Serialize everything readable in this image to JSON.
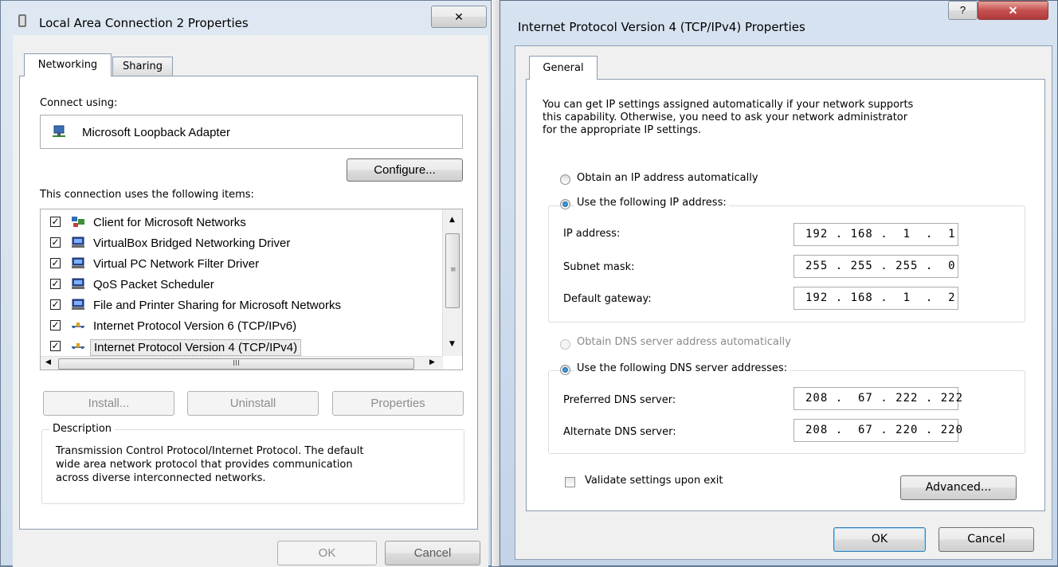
{
  "left_dialog": {
    "title": "Local Area Connection 2 Properties",
    "close_glyph": "✕",
    "tabs": [
      {
        "label": "Networking",
        "active": true
      },
      {
        "label": "Sharing",
        "active": false
      }
    ],
    "connect_using_label": "Connect using:",
    "adapter_name": "Microsoft Loopback Adapter",
    "configure_button": "Configure...",
    "items_label": "This connection uses the following items:",
    "items": [
      {
        "label": "Client for Microsoft Networks",
        "checked": true,
        "icon": "network-client-icon"
      },
      {
        "label": "VirtualBox Bridged Networking Driver",
        "checked": true,
        "icon": "network-service-icon"
      },
      {
        "label": "Virtual PC Network Filter Driver",
        "checked": true,
        "icon": "network-service-icon"
      },
      {
        "label": "QoS Packet Scheduler",
        "checked": true,
        "icon": "network-service-icon"
      },
      {
        "label": "File and Printer Sharing for Microsoft Networks",
        "checked": true,
        "icon": "network-service-icon"
      },
      {
        "label": "Internet Protocol Version 6 (TCP/IPv6)",
        "checked": true,
        "icon": "protocol-icon"
      },
      {
        "label": "Internet Protocol Version 4 (TCP/IPv4)",
        "checked": true,
        "icon": "protocol-icon",
        "selected": true
      }
    ],
    "hscroll_grip": "III",
    "install_button": "Install...",
    "uninstall_button": "Uninstall",
    "properties_button": "Properties",
    "description_label": "Description",
    "description_text": [
      "Transmission Control Protocol/Internet Protocol. The default",
      "wide area network protocol that provides communication",
      "across diverse interconnected networks."
    ],
    "ok_button": "OK",
    "cancel_button": "Cancel"
  },
  "right_dialog": {
    "title": "Internet Protocol Version 4 (TCP/IPv4) Properties",
    "help_glyph": "?",
    "close_glyph": "✕",
    "tab": "General",
    "intro": [
      "You can get IP settings assigned automatically if your network supports",
      "this capability. Otherwise, you need to ask your network administrator",
      "for the appropriate IP settings."
    ],
    "radio_auto_ip": "Obtain an IP address automatically",
    "radio_manual_ip": "Use the following IP address:",
    "ip_label": "IP address:",
    "ip_value": "192 . 168 .  1  .  1",
    "subnet_label": "Subnet mask:",
    "subnet_value": "255 . 255 . 255 .  0",
    "gateway_label": "Default gateway:",
    "gateway_value": "192 . 168 .  1  .  2",
    "radio_auto_dns": "Obtain DNS server address automatically",
    "radio_manual_dns": "Use the following DNS server addresses:",
    "preferred_dns_label": "Preferred DNS server:",
    "preferred_dns_value": "208 .  67 . 222 . 222",
    "alternate_dns_label": "Alternate DNS server:",
    "alternate_dns_value": "208 .  67 . 220 . 220",
    "validate_label": "Validate settings upon exit",
    "advanced_button": "Advanced...",
    "ok_button": "OK",
    "cancel_button": "Cancel"
  },
  "colors": {
    "accent": "#3399ff",
    "close_red": "#c75050",
    "selection": "#3399ff"
  }
}
